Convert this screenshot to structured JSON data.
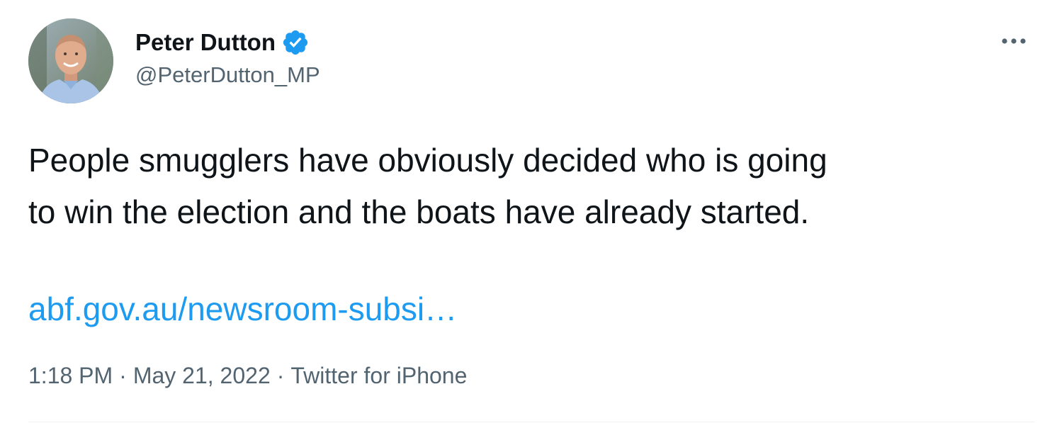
{
  "author": {
    "display_name": "Peter Dutton",
    "handle": "@PeterDutton_MP",
    "verified": true,
    "verified_icon": "verified-badge-icon",
    "avatar_icon": "profile-photo"
  },
  "menu": {
    "icon": "more-options-icon"
  },
  "tweet": {
    "text_lines": [
      "People smugglers have obviously decided who is going",
      "to win the election and the boats have already started."
    ],
    "link_text": "abf.gov.au/newsroom-subsi…"
  },
  "meta": {
    "time": "1:18 PM",
    "separator": "·",
    "date": "May 21, 2022",
    "source": "Twitter for iPhone"
  },
  "colors": {
    "text": "#0f1419",
    "secondary": "#536471",
    "link": "#1d9bf0",
    "verified_badge": "#1d9bf0",
    "divider": "#eff3f4"
  }
}
